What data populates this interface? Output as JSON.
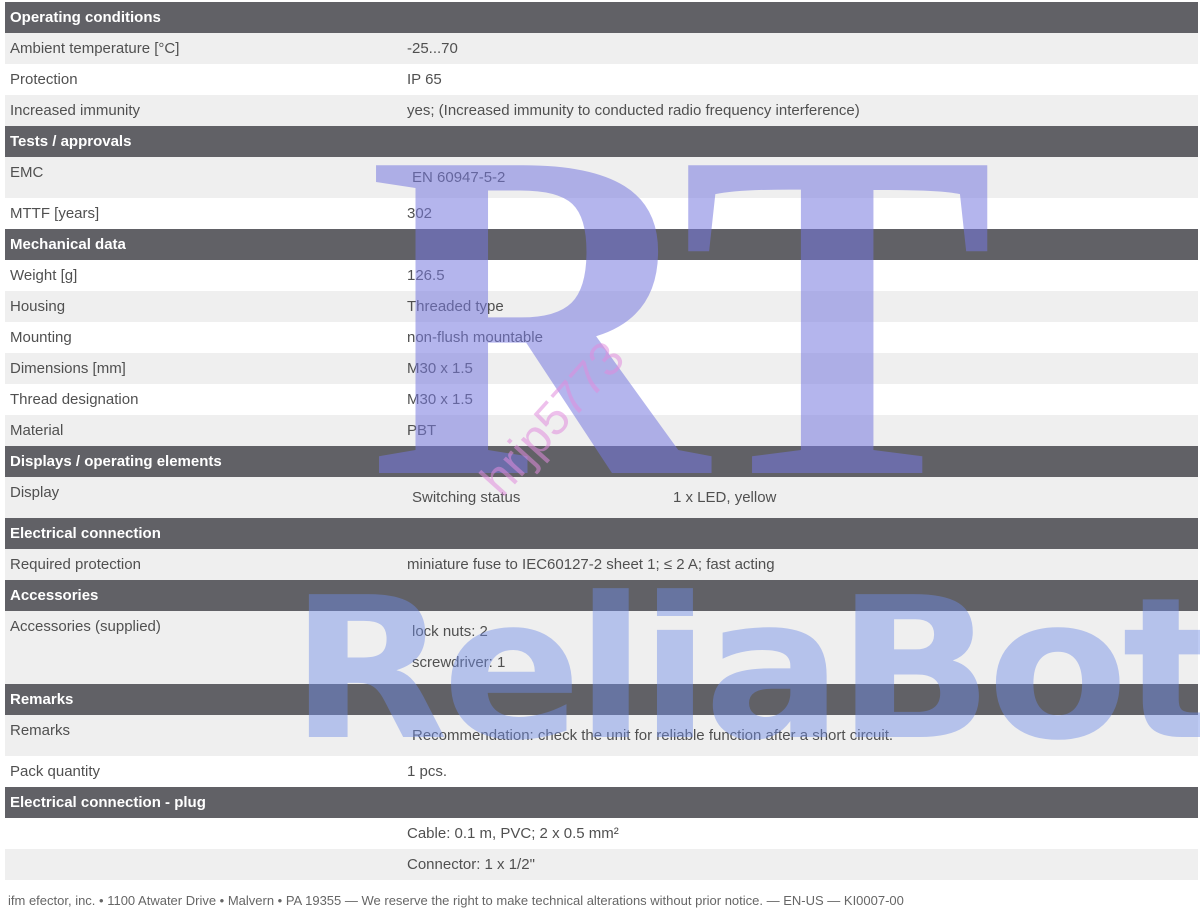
{
  "sections": {
    "operating": {
      "title": "Operating conditions",
      "ambient": {
        "label": "Ambient temperature [°C]",
        "value": "-25...70"
      },
      "protection": {
        "label": "Protection",
        "value": "IP 65"
      },
      "immunity": {
        "label": "Increased immunity",
        "value": "yes; (Increased immunity to conducted radio frequency interference)"
      }
    },
    "tests": {
      "title": "Tests / approvals",
      "emc": {
        "label": "EMC",
        "value": "EN 60947-5-2"
      },
      "mttf": {
        "label": "MTTF [years]",
        "value": "302"
      }
    },
    "mechanical": {
      "title": "Mechanical data",
      "weight": {
        "label": "Weight [g]",
        "value": "126.5"
      },
      "housing": {
        "label": "Housing",
        "value": "Threaded type"
      },
      "mounting": {
        "label": "Mounting",
        "value": "non-flush mountable"
      },
      "dimensions": {
        "label": "Dimensions [mm]",
        "value": "M30 x 1.5"
      },
      "thread": {
        "label": "Thread designation",
        "value": "M30 x 1.5"
      },
      "material": {
        "label": "Material",
        "value": "PBT"
      }
    },
    "displays": {
      "title": "Displays / operating elements",
      "display": {
        "label": "Display",
        "key": "Switching status",
        "value": "1 x LED, yellow"
      }
    },
    "electrical": {
      "title": "Electrical connection",
      "protection": {
        "label": "Required protection",
        "value": "miniature fuse to IEC60127-2 sheet 1; ≤ 2 A; fast acting"
      }
    },
    "accessories": {
      "title": "Accessories",
      "supplied": {
        "label": "Accessories (supplied)",
        "line1": "lock nuts: 2",
        "line2": "screwdriver: 1"
      }
    },
    "remarks": {
      "title": "Remarks",
      "remarks": {
        "label": "Remarks",
        "value": "Recommendation: check the unit for reliable function after a short circuit."
      },
      "pack": {
        "label": "Pack quantity",
        "value": "1 pcs."
      }
    },
    "plug": {
      "title": "Electrical connection - plug",
      "cable": "Cable: 0.1 m, PVC; 2 x 0.5 mm²",
      "connector": "Connector: 1 x 1/2\""
    }
  },
  "footer": "ifm efector, inc. • 1100 Atwater Drive • Malvern • PA 19355 — We reserve the right to make technical alterations without prior notice. — EN-US — KI0007-00",
  "watermark": {
    "monogram": "RT",
    "code": "hrjp5773",
    "brand": "ReliaBot"
  },
  "colors": {
    "section_header": "#616166",
    "row_alt": "#efefef"
  }
}
